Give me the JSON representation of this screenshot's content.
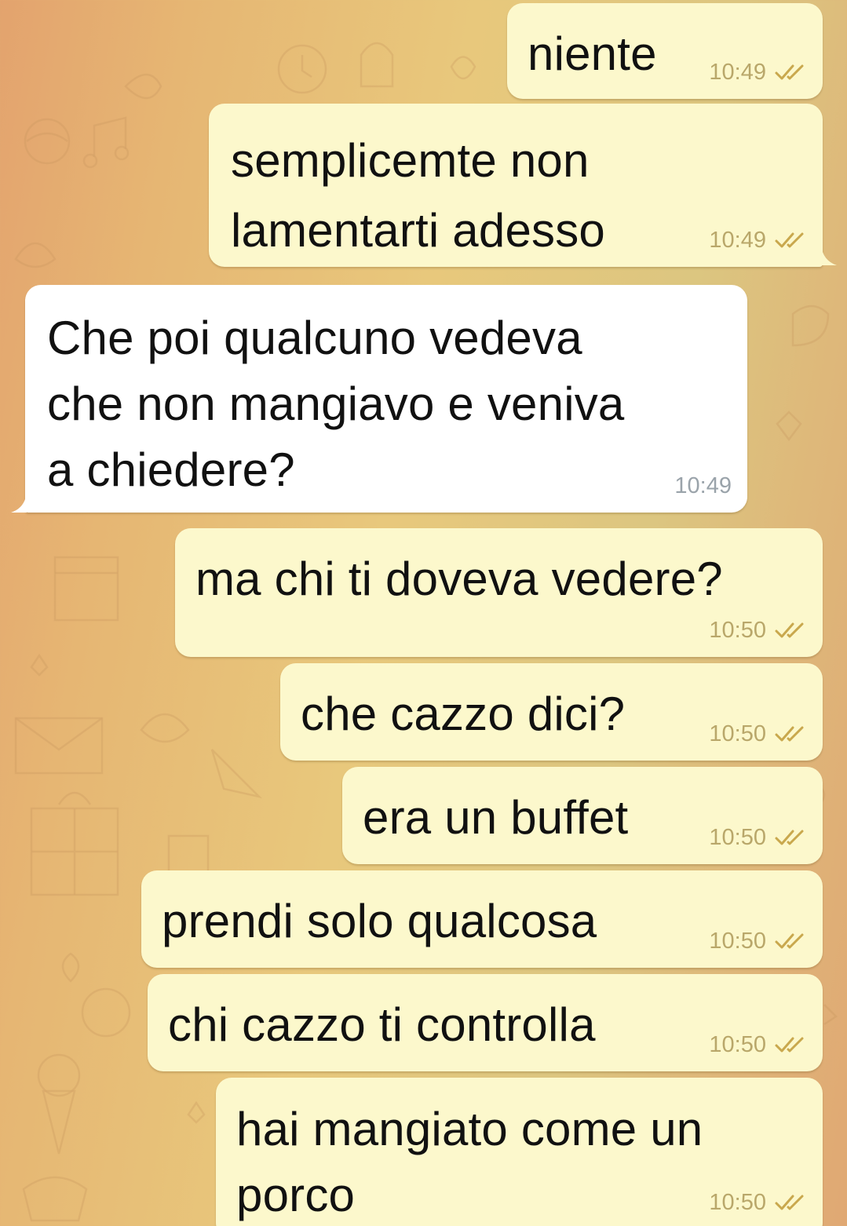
{
  "chat": {
    "messages": [
      {
        "id": "m1",
        "direction": "outgoing",
        "text": "niente",
        "time": "10:49",
        "status": "read"
      },
      {
        "id": "m2",
        "direction": "outgoing",
        "text": "semplicemte non\nlamentarti adesso",
        "time": "10:49",
        "status": "read"
      },
      {
        "id": "m3",
        "direction": "incoming",
        "text": "Che poi qualcuno vedeva\nche non mangiavo e veniva\na chiedere?",
        "time": "10:49"
      },
      {
        "id": "m4",
        "direction": "outgoing",
        "text": "ma chi ti doveva vedere?",
        "time": "10:50",
        "status": "read"
      },
      {
        "id": "m5",
        "direction": "outgoing",
        "text": "che cazzo dici?",
        "time": "10:50",
        "status": "read"
      },
      {
        "id": "m6",
        "direction": "outgoing",
        "text": "era un buffet",
        "time": "10:50",
        "status": "read"
      },
      {
        "id": "m7",
        "direction": "outgoing",
        "text": "prendi solo qualcosa",
        "time": "10:50",
        "status": "read"
      },
      {
        "id": "m8",
        "direction": "outgoing",
        "text": "chi cazzo ti controlla",
        "time": "10:50",
        "status": "read"
      },
      {
        "id": "m9",
        "direction": "outgoing",
        "text": "hai mangiato come un\nporco",
        "time": "10:50",
        "status": "read"
      }
    ]
  },
  "theme": {
    "outgoing_bubble": "#fcf8cc",
    "incoming_bubble": "#ffffff",
    "read_check": "#c9a84d"
  },
  "icons": {
    "read_status": "double-check-icon"
  }
}
